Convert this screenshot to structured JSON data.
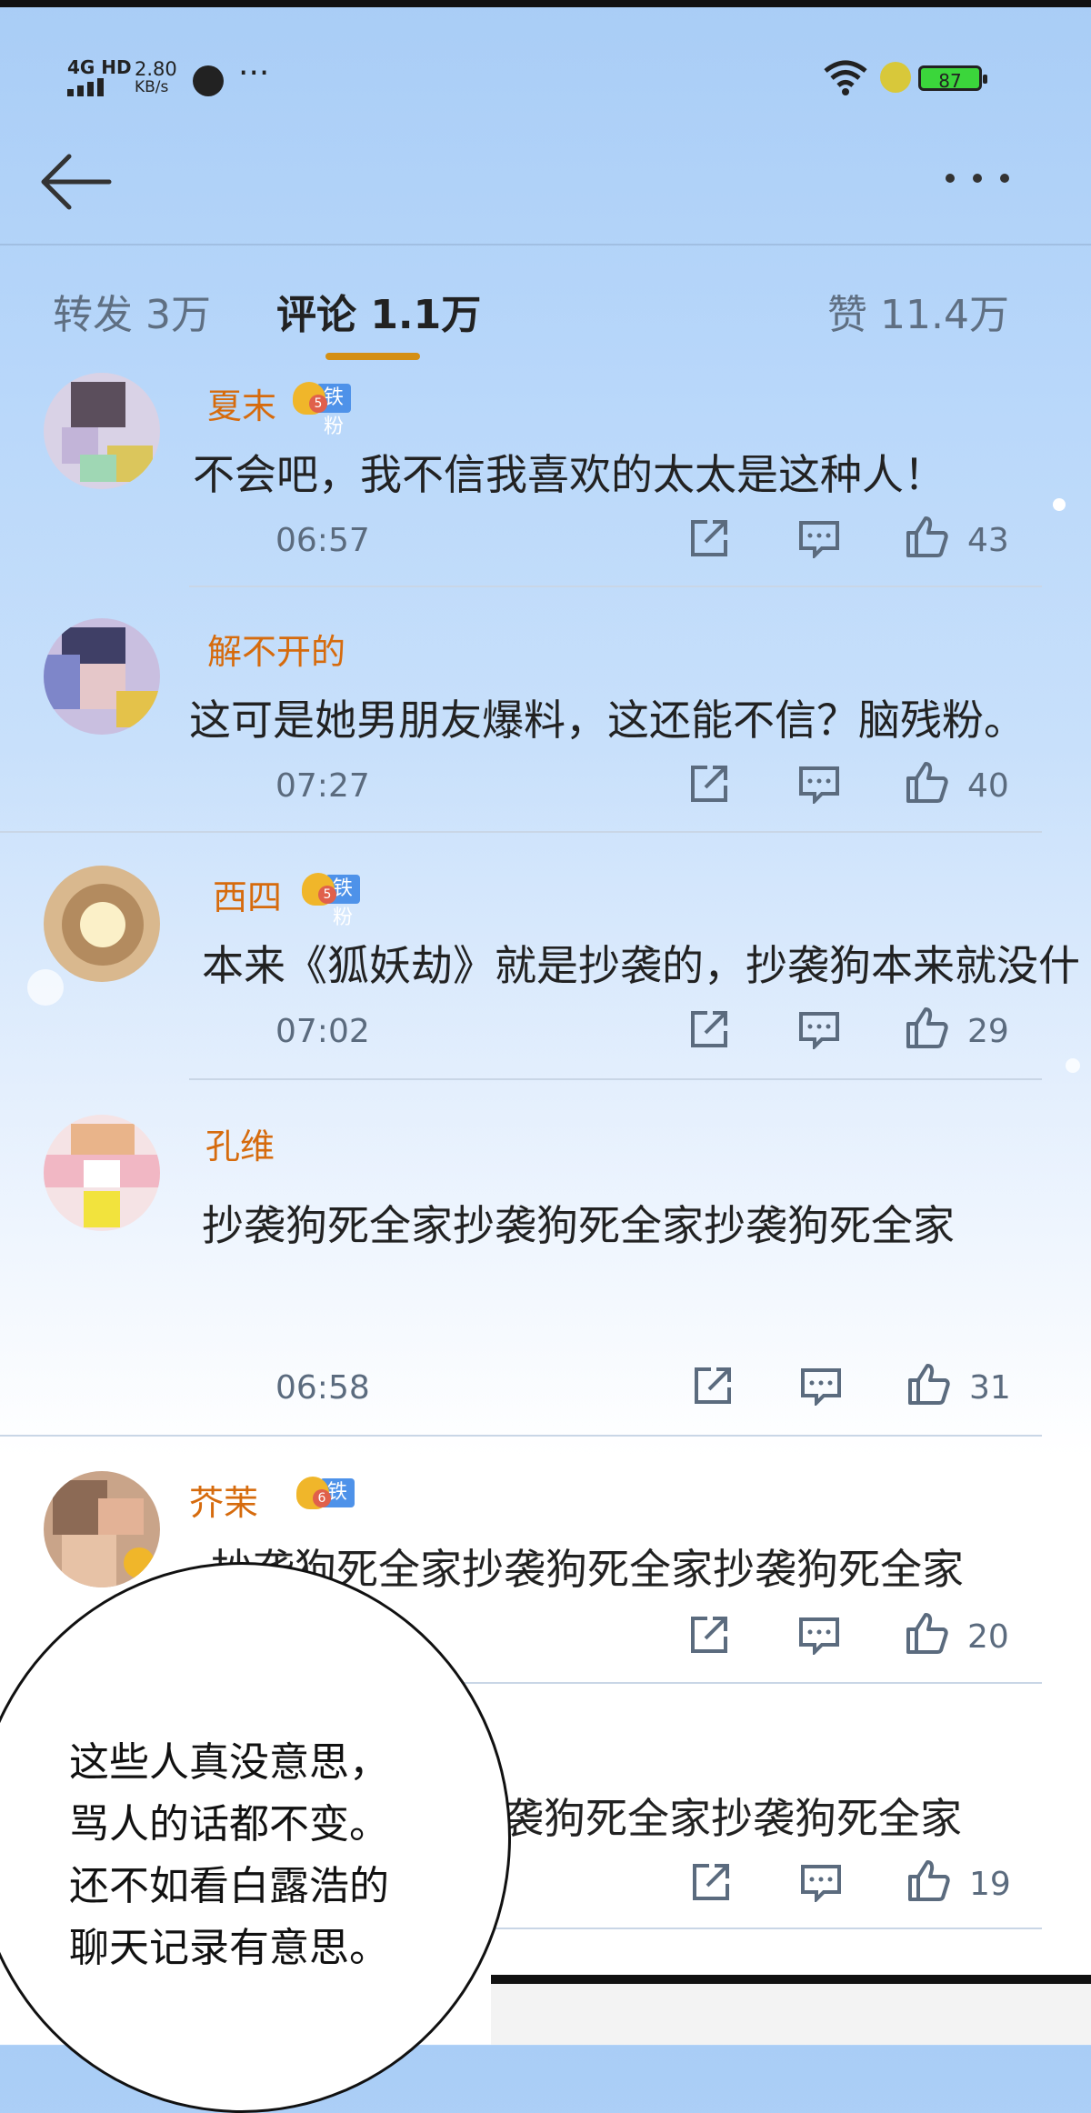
{
  "status_bar": {
    "network": "4G HD",
    "speed_value": "2.80",
    "speed_unit": "KB/s",
    "battery": "87"
  },
  "tabs": [
    {
      "label": "转发 3万"
    },
    {
      "label": "评论 1.1万"
    },
    {
      "label": "赞 11.4万"
    }
  ],
  "comments": [
    {
      "name": "夏末",
      "badge_level": "5",
      "badge_label": "铁粉",
      "text": "不会吧，我不信我喜欢的太太是这种人！",
      "time": "06:57",
      "likes": "43"
    },
    {
      "name": "解不开的",
      "text": "这可是她男朋友爆料，这还能不信？脑残粉。",
      "time": "07:27",
      "likes": "40"
    },
    {
      "name": "西四",
      "badge_level": "5",
      "badge_label": "铁粉",
      "text": "本来《狐妖劫》就是抄袭的，抄袭狗本来就没什",
      "time": "07:02",
      "likes": "29"
    },
    {
      "name": "孔维",
      "text": "抄袭狗死全家抄袭狗死全家抄袭狗死全家",
      "time": "06:58",
      "likes": "31"
    },
    {
      "name": "芥茉",
      "badge_level": "6",
      "badge_label": "铁粉",
      "text": "抄袭狗死全家抄袭狗死全家抄袭狗死全家",
      "likes": "20"
    },
    {
      "text": "袭狗死全家抄袭狗死全家",
      "likes": "19"
    }
  ],
  "bubble": {
    "lines": [
      "这些人真没意思，",
      "骂人的话都不变。",
      "还不如看白露浩的",
      "聊天记录有意思。"
    ]
  },
  "colors": {
    "accent": "#d48f14",
    "name": "#d66b0d",
    "badge": "#4e92e9"
  }
}
